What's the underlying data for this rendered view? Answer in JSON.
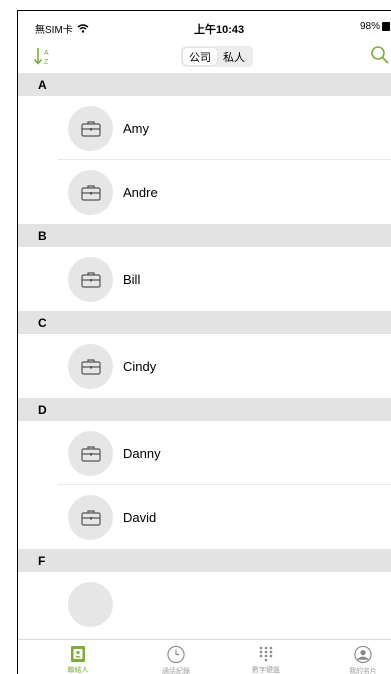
{
  "status_bar": {
    "carrier": "無SIM卡",
    "time": "上午10:43",
    "battery": "98%"
  },
  "nav": {
    "segments": [
      {
        "label": "公司",
        "active": true
      },
      {
        "label": "私人",
        "active": false
      }
    ],
    "sort_icon": "sort-az-icon",
    "search_icon": "search-icon",
    "accent_color": "#7cad3a"
  },
  "contacts": {
    "sections": [
      {
        "letter": "A",
        "items": [
          {
            "name": "Amy"
          },
          {
            "name": "Andre"
          }
        ]
      },
      {
        "letter": "B",
        "items": [
          {
            "name": "Bill"
          }
        ]
      },
      {
        "letter": "C",
        "items": [
          {
            "name": "Cindy"
          }
        ]
      },
      {
        "letter": "D",
        "items": [
          {
            "name": "Danny"
          },
          {
            "name": "David"
          }
        ]
      },
      {
        "letter": "F",
        "items": []
      }
    ],
    "avatar_icon": "briefcase-icon"
  },
  "tabs": [
    {
      "label": "聯絡人",
      "icon": "contacts-icon",
      "active": true
    },
    {
      "label": "通話紀錄",
      "icon": "clock-icon",
      "active": false
    },
    {
      "label": "數字鍵盤",
      "icon": "keypad-icon",
      "active": false
    },
    {
      "label": "我的名片",
      "icon": "profile-icon",
      "active": false
    }
  ]
}
